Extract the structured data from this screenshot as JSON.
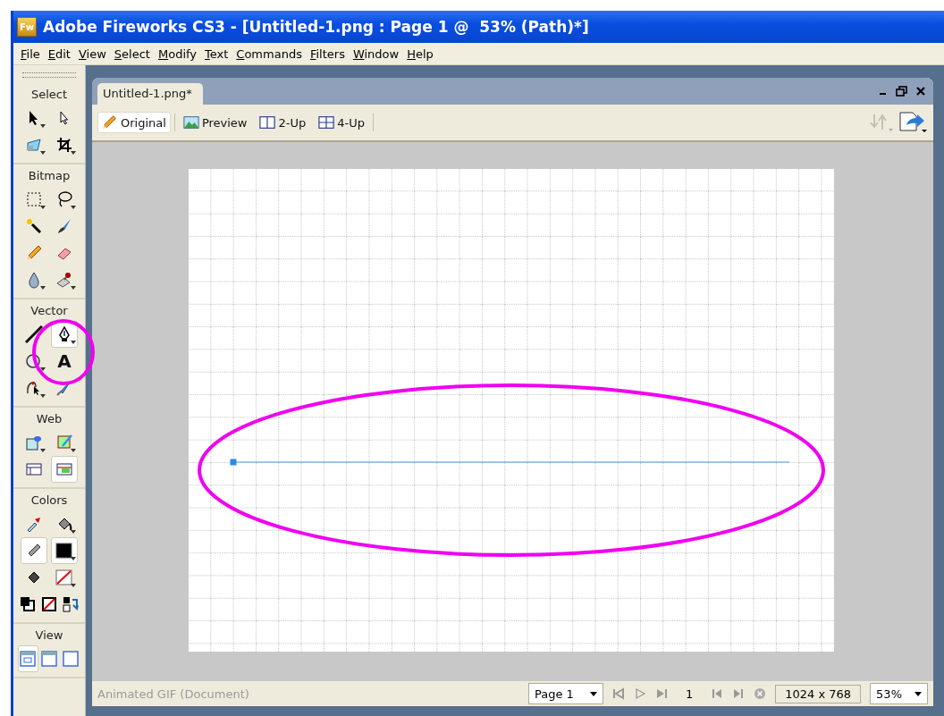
{
  "window": {
    "app_icon": "Fw",
    "title": "Adobe Fireworks CS3 - [Untitled-1.png : Page 1 @  53% (Path)*]"
  },
  "menu": [
    "File",
    "Edit",
    "View",
    "Select",
    "Modify",
    "Text",
    "Commands",
    "Filters",
    "Window",
    "Help"
  ],
  "tools": [
    {
      "title": "Select",
      "rows": [
        [
          {
            "kind": "pointer",
            "selected": false,
            "flyout": true
          },
          {
            "kind": "subselect",
            "selected": false,
            "flyout": false
          }
        ],
        [
          {
            "kind": "scale",
            "selected": false,
            "flyout": true
          },
          {
            "kind": "crop",
            "selected": false,
            "flyout": true
          }
        ]
      ]
    },
    {
      "title": "Bitmap",
      "rows": [
        [
          {
            "kind": "marquee",
            "selected": false,
            "flyout": true
          },
          {
            "kind": "lasso",
            "selected": false,
            "flyout": true
          }
        ],
        [
          {
            "kind": "wand",
            "selected": false,
            "flyout": false
          },
          {
            "kind": "brush",
            "selected": false,
            "flyout": false
          }
        ],
        [
          {
            "kind": "pencil",
            "selected": false,
            "flyout": false
          },
          {
            "kind": "eraser",
            "selected": false,
            "flyout": false
          }
        ],
        [
          {
            "kind": "blur",
            "selected": false,
            "flyout": true
          },
          {
            "kind": "stamp",
            "selected": false,
            "flyout": true
          }
        ]
      ]
    },
    {
      "title": "Vector",
      "rows": [
        [
          {
            "kind": "line",
            "selected": false,
            "flyout": false
          },
          {
            "kind": "pen",
            "selected": true,
            "flyout": true
          }
        ],
        [
          {
            "kind": "ellipse",
            "selected": false,
            "flyout": true
          },
          {
            "kind": "text",
            "glyph": "A",
            "selected": false,
            "flyout": false
          }
        ],
        [
          {
            "kind": "freeform",
            "selected": false,
            "flyout": true
          },
          {
            "kind": "knife",
            "selected": false,
            "flyout": false
          }
        ]
      ]
    },
    {
      "title": "Web",
      "rows": [
        [
          {
            "kind": "hotspot",
            "selected": false,
            "flyout": true
          },
          {
            "kind": "slice",
            "selected": false,
            "flyout": true
          }
        ],
        [
          {
            "kind": "hide-slices",
            "selected": false,
            "flyout": false
          },
          {
            "kind": "show-slices",
            "selected": true,
            "flyout": false
          }
        ]
      ]
    },
    {
      "title": "Colors",
      "rows": [
        [
          {
            "kind": "eyedropper",
            "selected": false,
            "flyout": false
          },
          {
            "kind": "bucket",
            "selected": false,
            "flyout": true
          }
        ],
        [
          {
            "kind": "stroke",
            "selected": true,
            "flyout": false
          },
          {
            "kind": "swatch-black",
            "selected": true,
            "flyout": true
          }
        ],
        [
          {
            "kind": "fill",
            "selected": false,
            "flyout": false
          },
          {
            "kind": "swatch-none",
            "selected": false,
            "flyout": true
          }
        ],
        [
          {
            "kind": "default-colors",
            "selected": false,
            "flyout": false
          },
          {
            "kind": "no-color",
            "selected": false,
            "flyout": false
          },
          {
            "kind": "swap",
            "selected": false,
            "flyout": false
          }
        ]
      ]
    },
    {
      "title": "View",
      "rows": [
        [
          {
            "kind": "standard-mode",
            "selected": true,
            "flyout": false
          },
          {
            "kind": "menu-mode",
            "selected": false,
            "flyout": false
          },
          {
            "kind": "full-mode",
            "selected": false,
            "flyout": false
          }
        ]
      ]
    }
  ],
  "document": {
    "tab": "Untitled-1.png*",
    "view_tabs": [
      {
        "kind": "original",
        "label": "Original",
        "selected": true
      },
      {
        "kind": "preview",
        "label": "Preview",
        "selected": false
      },
      {
        "kind": "two-up",
        "label": "2-Up",
        "selected": false
      },
      {
        "kind": "four-up",
        "label": "4-Up",
        "selected": false
      }
    ],
    "status": {
      "format": "Animated GIF (Document)",
      "page": "Page 1",
      "frame": "1",
      "size": "1024 x 768",
      "zoom": "53%"
    }
  }
}
